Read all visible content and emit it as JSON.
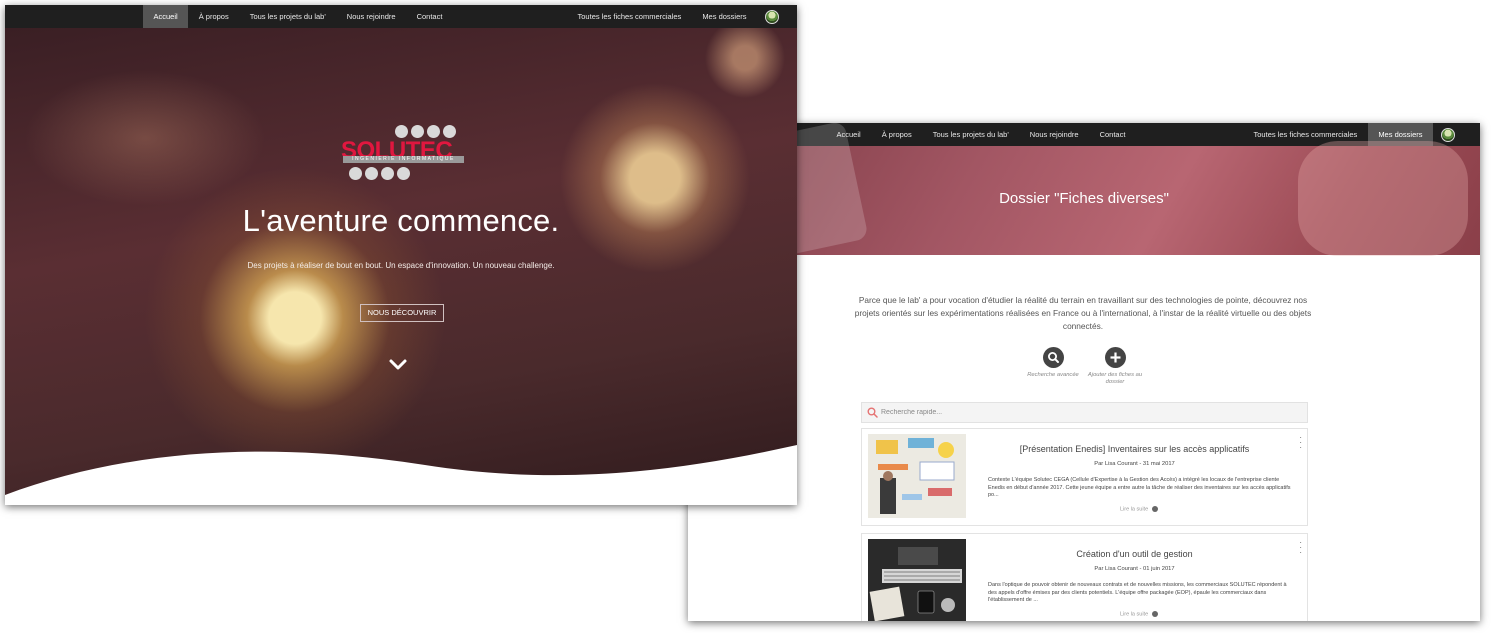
{
  "front": {
    "nav": {
      "items": [
        {
          "label": "Accueil",
          "active": true
        },
        {
          "label": "À propos"
        },
        {
          "label": "Tous les projets du lab'"
        },
        {
          "label": "Nous rejoindre"
        },
        {
          "label": "Contact"
        }
      ],
      "right_items": [
        {
          "label": "Toutes les fiches commerciales"
        },
        {
          "label": "Mes dossiers"
        }
      ]
    },
    "logo": {
      "brand": "SOLUTEC",
      "tagline": "INGENIERIE INFORMATIQUE",
      "accent_color": "#e0173f"
    },
    "hero": {
      "title": "L'aventure commence.",
      "subtitle": "Des projets à réaliser de bout en bout. Un espace d'innovation. Un nouveau challenge.",
      "cta": "NOUS DÉCOUVRIR",
      "scroll_icon": "chevron-down-icon"
    }
  },
  "back": {
    "nav": {
      "items": [
        {
          "label": "Accueil"
        },
        {
          "label": "À propos"
        },
        {
          "label": "Tous les projets du lab'"
        },
        {
          "label": "Nous rejoindre"
        },
        {
          "label": "Contact"
        }
      ],
      "right_items": [
        {
          "label": "Toutes les fiches commerciales"
        },
        {
          "label": "Mes dossiers",
          "active": true
        }
      ]
    },
    "banner_title": "Dossier \"Fiches diverses\"",
    "intro": "Parce que le lab' a pour vocation d'étudier la réalité du terrain en travaillant sur des technologies de pointe, découvrez nos projets orientés sur les expérimentations réalisées en France ou à l'international, à l'instar de la réalité virtuelle ou des objets connectés.",
    "actions": [
      {
        "label": "Recherche avancée",
        "icon": "search-icon"
      },
      {
        "label": "Ajouter des fiches au dossier",
        "icon": "plus-icon"
      }
    ],
    "search": {
      "placeholder": "Recherche rapide..."
    },
    "cards": [
      {
        "title": "[Présentation Enedis] Inventaires sur les accès applicatifs",
        "meta": "Par Lisa Courant - 31 mai 2017",
        "excerpt": "Contexte L'équipe Solutec CEGA (Cellule d'Expertise à la Gestion des Accès) a intégré les locaux de l'entreprise cliente Enedis en début d'année 2017. Cette jeune équipe a entre autre la tâche de réaliser des inventaires sur les accès applicatifs po...",
        "more": "Lire la suite"
      },
      {
        "title": "Création d'un outil de gestion",
        "meta": "Par Lisa Courant - 01 juin 2017",
        "excerpt": "Dans l'optique de pouvoir obtenir de nouveaux contrats et de nouvelles missions, les commerciaux SOLUTEC répondent à des appels d'offre émises par des clients potentiels. L'équipe offre packagée (EOP), épaule les commerciaux dans l'établissement de ...",
        "more": "Lire la suite"
      }
    ]
  }
}
